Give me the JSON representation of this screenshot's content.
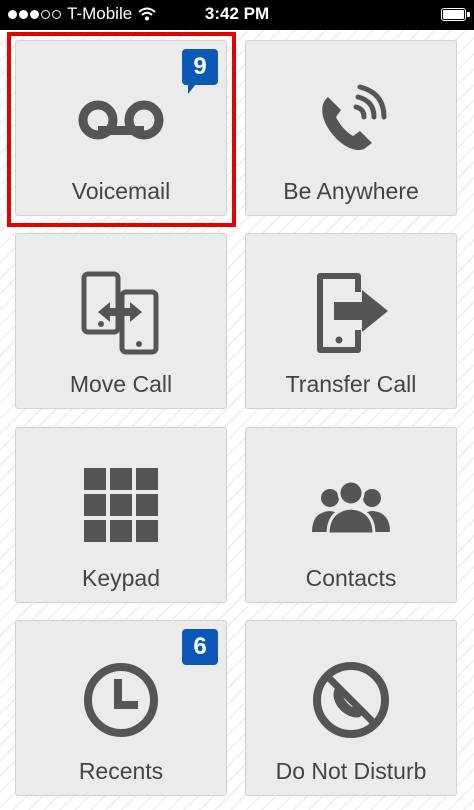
{
  "status_bar": {
    "carrier": "T-Mobile",
    "time": "3:42 PM",
    "signal_filled": 3,
    "signal_total": 5
  },
  "tiles": [
    {
      "label": "Voicemail",
      "icon": "voicemail-icon",
      "badge": "9"
    },
    {
      "label": "Be Anywhere",
      "icon": "phone-ringing-icon"
    },
    {
      "label": "Move Call",
      "icon": "move-call-icon"
    },
    {
      "label": "Transfer Call",
      "icon": "transfer-call-icon"
    },
    {
      "label": "Keypad",
      "icon": "keypad-icon"
    },
    {
      "label": "Contacts",
      "icon": "contacts-icon"
    },
    {
      "label": "Recents",
      "icon": "clock-icon",
      "badge": "6"
    },
    {
      "label": "Do Not Disturb",
      "icon": "do-not-disturb-icon"
    }
  ],
  "colors": {
    "badge": "#0b59b5",
    "highlight": "#e60000",
    "icon": "#555555",
    "tile_bg": "#ebebeb"
  }
}
